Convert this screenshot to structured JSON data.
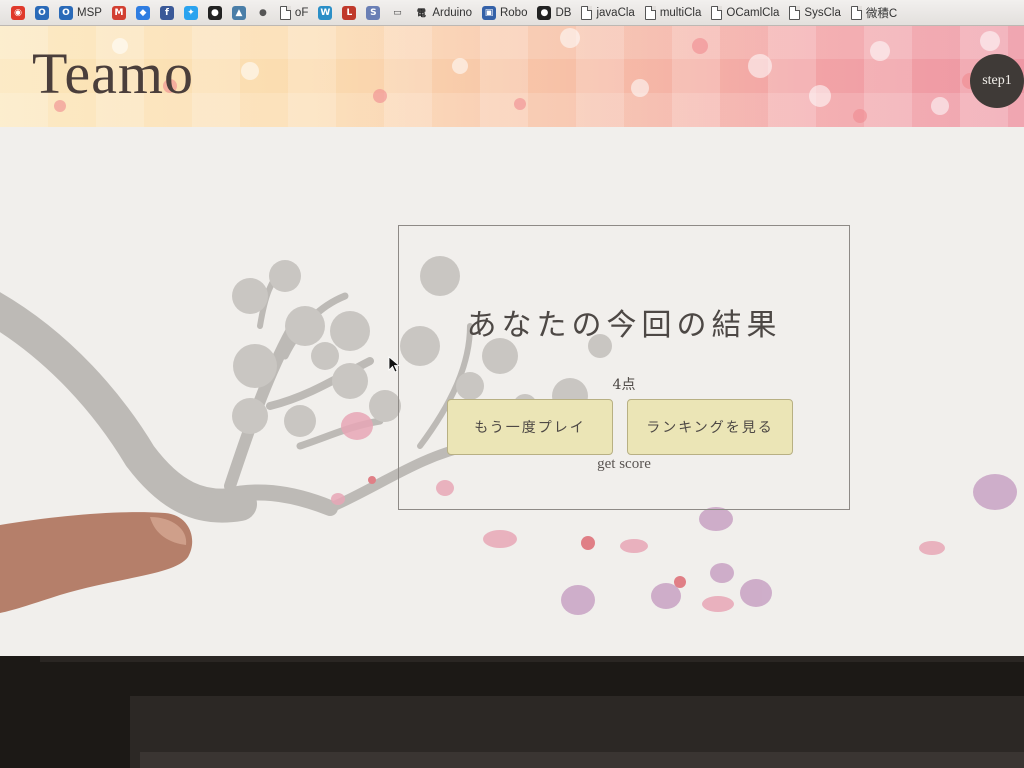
{
  "bookmarks": [
    {
      "label": "",
      "icon": "red-circle-icon",
      "color": "#e0392b"
    },
    {
      "label": "",
      "icon": "outlook-icon",
      "color": "#2a6ab8"
    },
    {
      "label": "MSP",
      "icon": "outlook-icon",
      "color": "#2a6ab8"
    },
    {
      "label": "",
      "icon": "gmail-icon",
      "color": "#d23f31"
    },
    {
      "label": "",
      "icon": "dropbox-icon",
      "color": "#2f7de1"
    },
    {
      "label": "",
      "icon": "facebook-icon",
      "color": "#3b5998"
    },
    {
      "label": "",
      "icon": "twitter-icon",
      "color": "#2aa3ef"
    },
    {
      "label": "",
      "icon": "github-icon",
      "color": "#222222"
    },
    {
      "label": "",
      "icon": "bookmark-icon",
      "color": "#4a7ea8"
    },
    {
      "label": "",
      "icon": "apple-icon",
      "color": "#555555"
    },
    {
      "label": "oF",
      "icon": "document-icon",
      "color": "#ffffff"
    },
    {
      "label": "",
      "icon": "w-icon",
      "color": "#2b8fc7"
    },
    {
      "label": "",
      "icon": "lr-icon",
      "color": "#c0392b"
    },
    {
      "label": "",
      "icon": "script-icon",
      "color": "#6a7fb5"
    },
    {
      "label": "",
      "icon": "tv-icon",
      "color": "#444444"
    },
    {
      "label": "Arduino",
      "icon": "kanji-icon",
      "color": "#222222"
    },
    {
      "label": "Robo",
      "icon": "windows-icon",
      "color": "#3461a8"
    },
    {
      "label": "DB",
      "icon": "github-icon",
      "color": "#222222"
    },
    {
      "label": "javaCla",
      "icon": "document-icon",
      "color": "#ffffff"
    },
    {
      "label": "multiCla",
      "icon": "document-icon",
      "color": "#ffffff"
    },
    {
      "label": "OCamlCla",
      "icon": "document-icon",
      "color": "#ffffff"
    },
    {
      "label": "SysCla",
      "icon": "document-icon",
      "color": "#ffffff"
    },
    {
      "label": "微積C",
      "icon": "document-icon",
      "color": "#ffffff"
    }
  ],
  "header": {
    "site_title": "Teamo",
    "step_badge": "step1"
  },
  "result": {
    "title": "あなたの今回の結果",
    "score": "4点",
    "replay_label": "もう一度プレイ",
    "ranking_label": "ランキングを見る",
    "score_caption": "get score"
  },
  "colors": {
    "page_bg": "#f1efec",
    "button_bg": "#ebe5b6",
    "badge_bg": "#3f3a37",
    "petal_pink": "#e3a3b4",
    "branch_gray": "#b9b6b3"
  }
}
